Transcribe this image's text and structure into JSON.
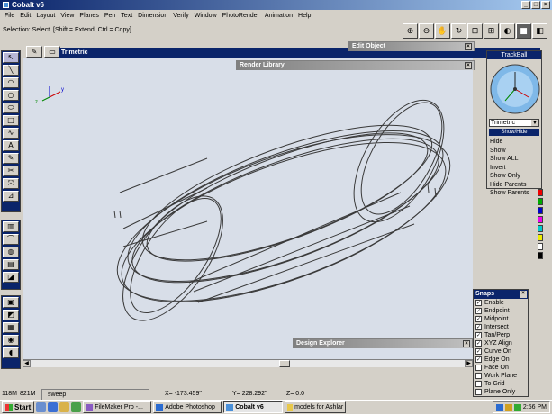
{
  "window": {
    "title": "Cobalt v6"
  },
  "menu": [
    "File",
    "Edit",
    "Layout",
    "View",
    "Planes",
    "Pen",
    "Text",
    "Dimension",
    "Verify",
    "Window",
    "PhotoRender",
    "Animation",
    "Help"
  ],
  "status_line": "Selection: Select. [Shift = Extend, Ctrl = Copy]",
  "viewport": {
    "title": "Trimetric"
  },
  "panels": {
    "edit_object": "Edit Object",
    "render_library": "Render Library",
    "design_explorer": "Design Explorer"
  },
  "trackball": {
    "title": "TrackBall",
    "view": "Trimetric",
    "show_hide_title": "Show/Hide",
    "menu": [
      "Hide",
      "Show",
      "Show ALL",
      "Invert",
      "Show Only",
      "Hide Parents",
      "Show Parents"
    ]
  },
  "snaps": {
    "title": "Snaps",
    "items": [
      {
        "label": "Enable",
        "checked": true
      },
      {
        "label": "Endpoint",
        "checked": true
      },
      {
        "label": "Midpoint",
        "checked": true
      },
      {
        "label": "Intersect",
        "checked": true
      },
      {
        "label": "Tan/Perp",
        "checked": true
      },
      {
        "label": "XYZ Align",
        "checked": true
      },
      {
        "label": "Curve On",
        "checked": true
      },
      {
        "label": "Edge On",
        "checked": true
      },
      {
        "label": "Face On",
        "checked": false
      },
      {
        "label": "Work Plane",
        "checked": false
      },
      {
        "label": "To Grid",
        "checked": false
      },
      {
        "label": "Plane Only",
        "checked": false
      }
    ]
  },
  "statusbar": {
    "memory_1": "118M",
    "memory_2": "821M",
    "command": "sweep",
    "x": "X= -173.459\"",
    "y": "Y= 228.292\"",
    "z": "Z= 0.0"
  },
  "taskbar": {
    "start": "Start",
    "tasks": [
      {
        "label": "FileMaker Pro -...",
        "active": false
      },
      {
        "label": "Adobe Photoshop",
        "active": false
      },
      {
        "label": "Cobalt v6",
        "active": true
      },
      {
        "label": "models for Ashlar",
        "active": false
      }
    ],
    "clock": "2:56 PM"
  },
  "axis_labels": {
    "y": "y",
    "z": "z"
  },
  "colors": {
    "title_bar": "#0a246a",
    "viewport_bg": "#d8dee8",
    "trackball_sphere": "#7fb8e8"
  },
  "icons": [
    "zoom-in-icon",
    "zoom-out-icon",
    "pan-hand-icon",
    "rotate-icon",
    "zoom-window-icon",
    "zoom-extents-icon",
    "render-icon",
    "cube-icon",
    "cube-shaded-icon"
  ]
}
